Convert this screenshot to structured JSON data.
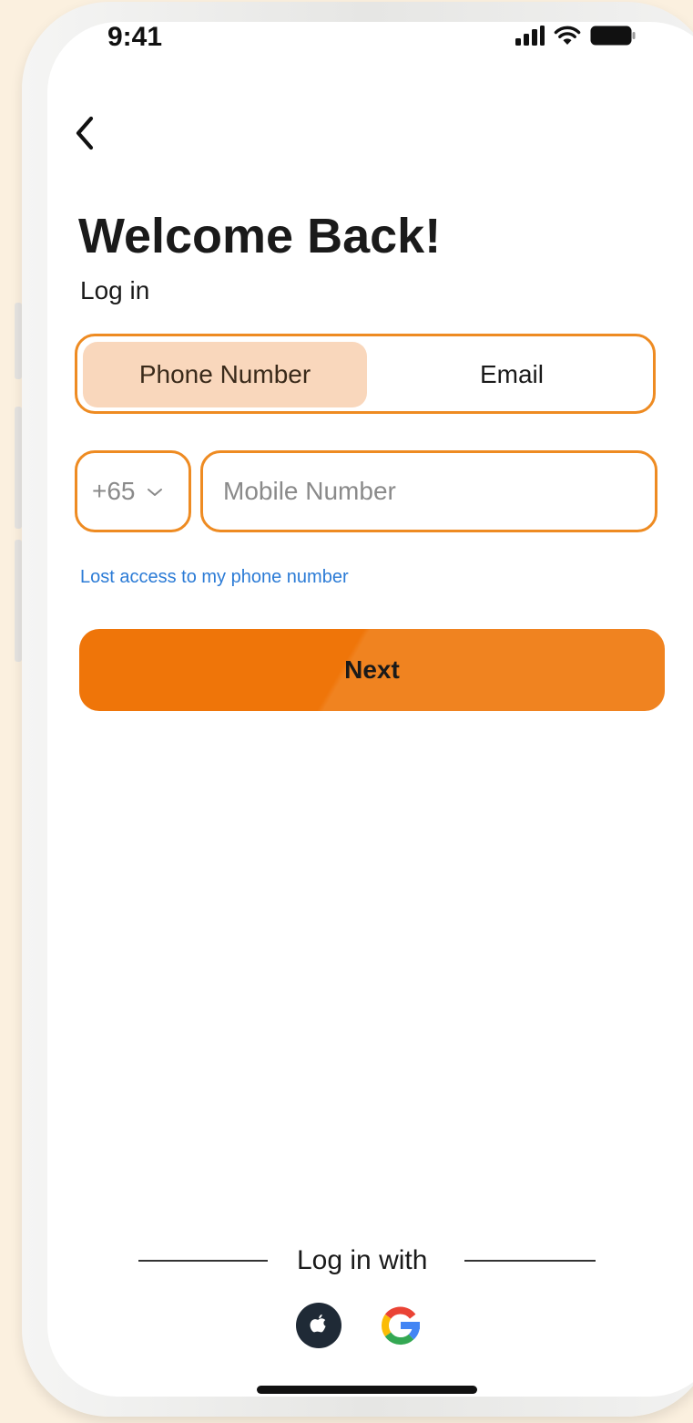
{
  "status_bar": {
    "time": "9:41",
    "icons": [
      "signal-icon",
      "wifi-icon",
      "battery-icon"
    ]
  },
  "header": {
    "back_icon": "chevron-left-icon",
    "title": "Welcome Back!",
    "subtitle": "Log in"
  },
  "login_method": {
    "tabs": [
      {
        "label": "Phone Number",
        "selected": true
      },
      {
        "label": "Email",
        "selected": false
      }
    ]
  },
  "phone_form": {
    "country_code": "+65",
    "mobile_placeholder": "Mobile Number",
    "lost_access_link": "Lost access to my phone number",
    "next_label": "Next"
  },
  "social_login": {
    "label": "Log in with",
    "providers": [
      "apple-icon",
      "google-icon"
    ]
  },
  "colors": {
    "accent": "#ee8b22",
    "button": "#ef7509",
    "tab_selected_bg": "#f9d7bc",
    "link": "#2b7bd6",
    "page_background": "#fbf0df"
  }
}
